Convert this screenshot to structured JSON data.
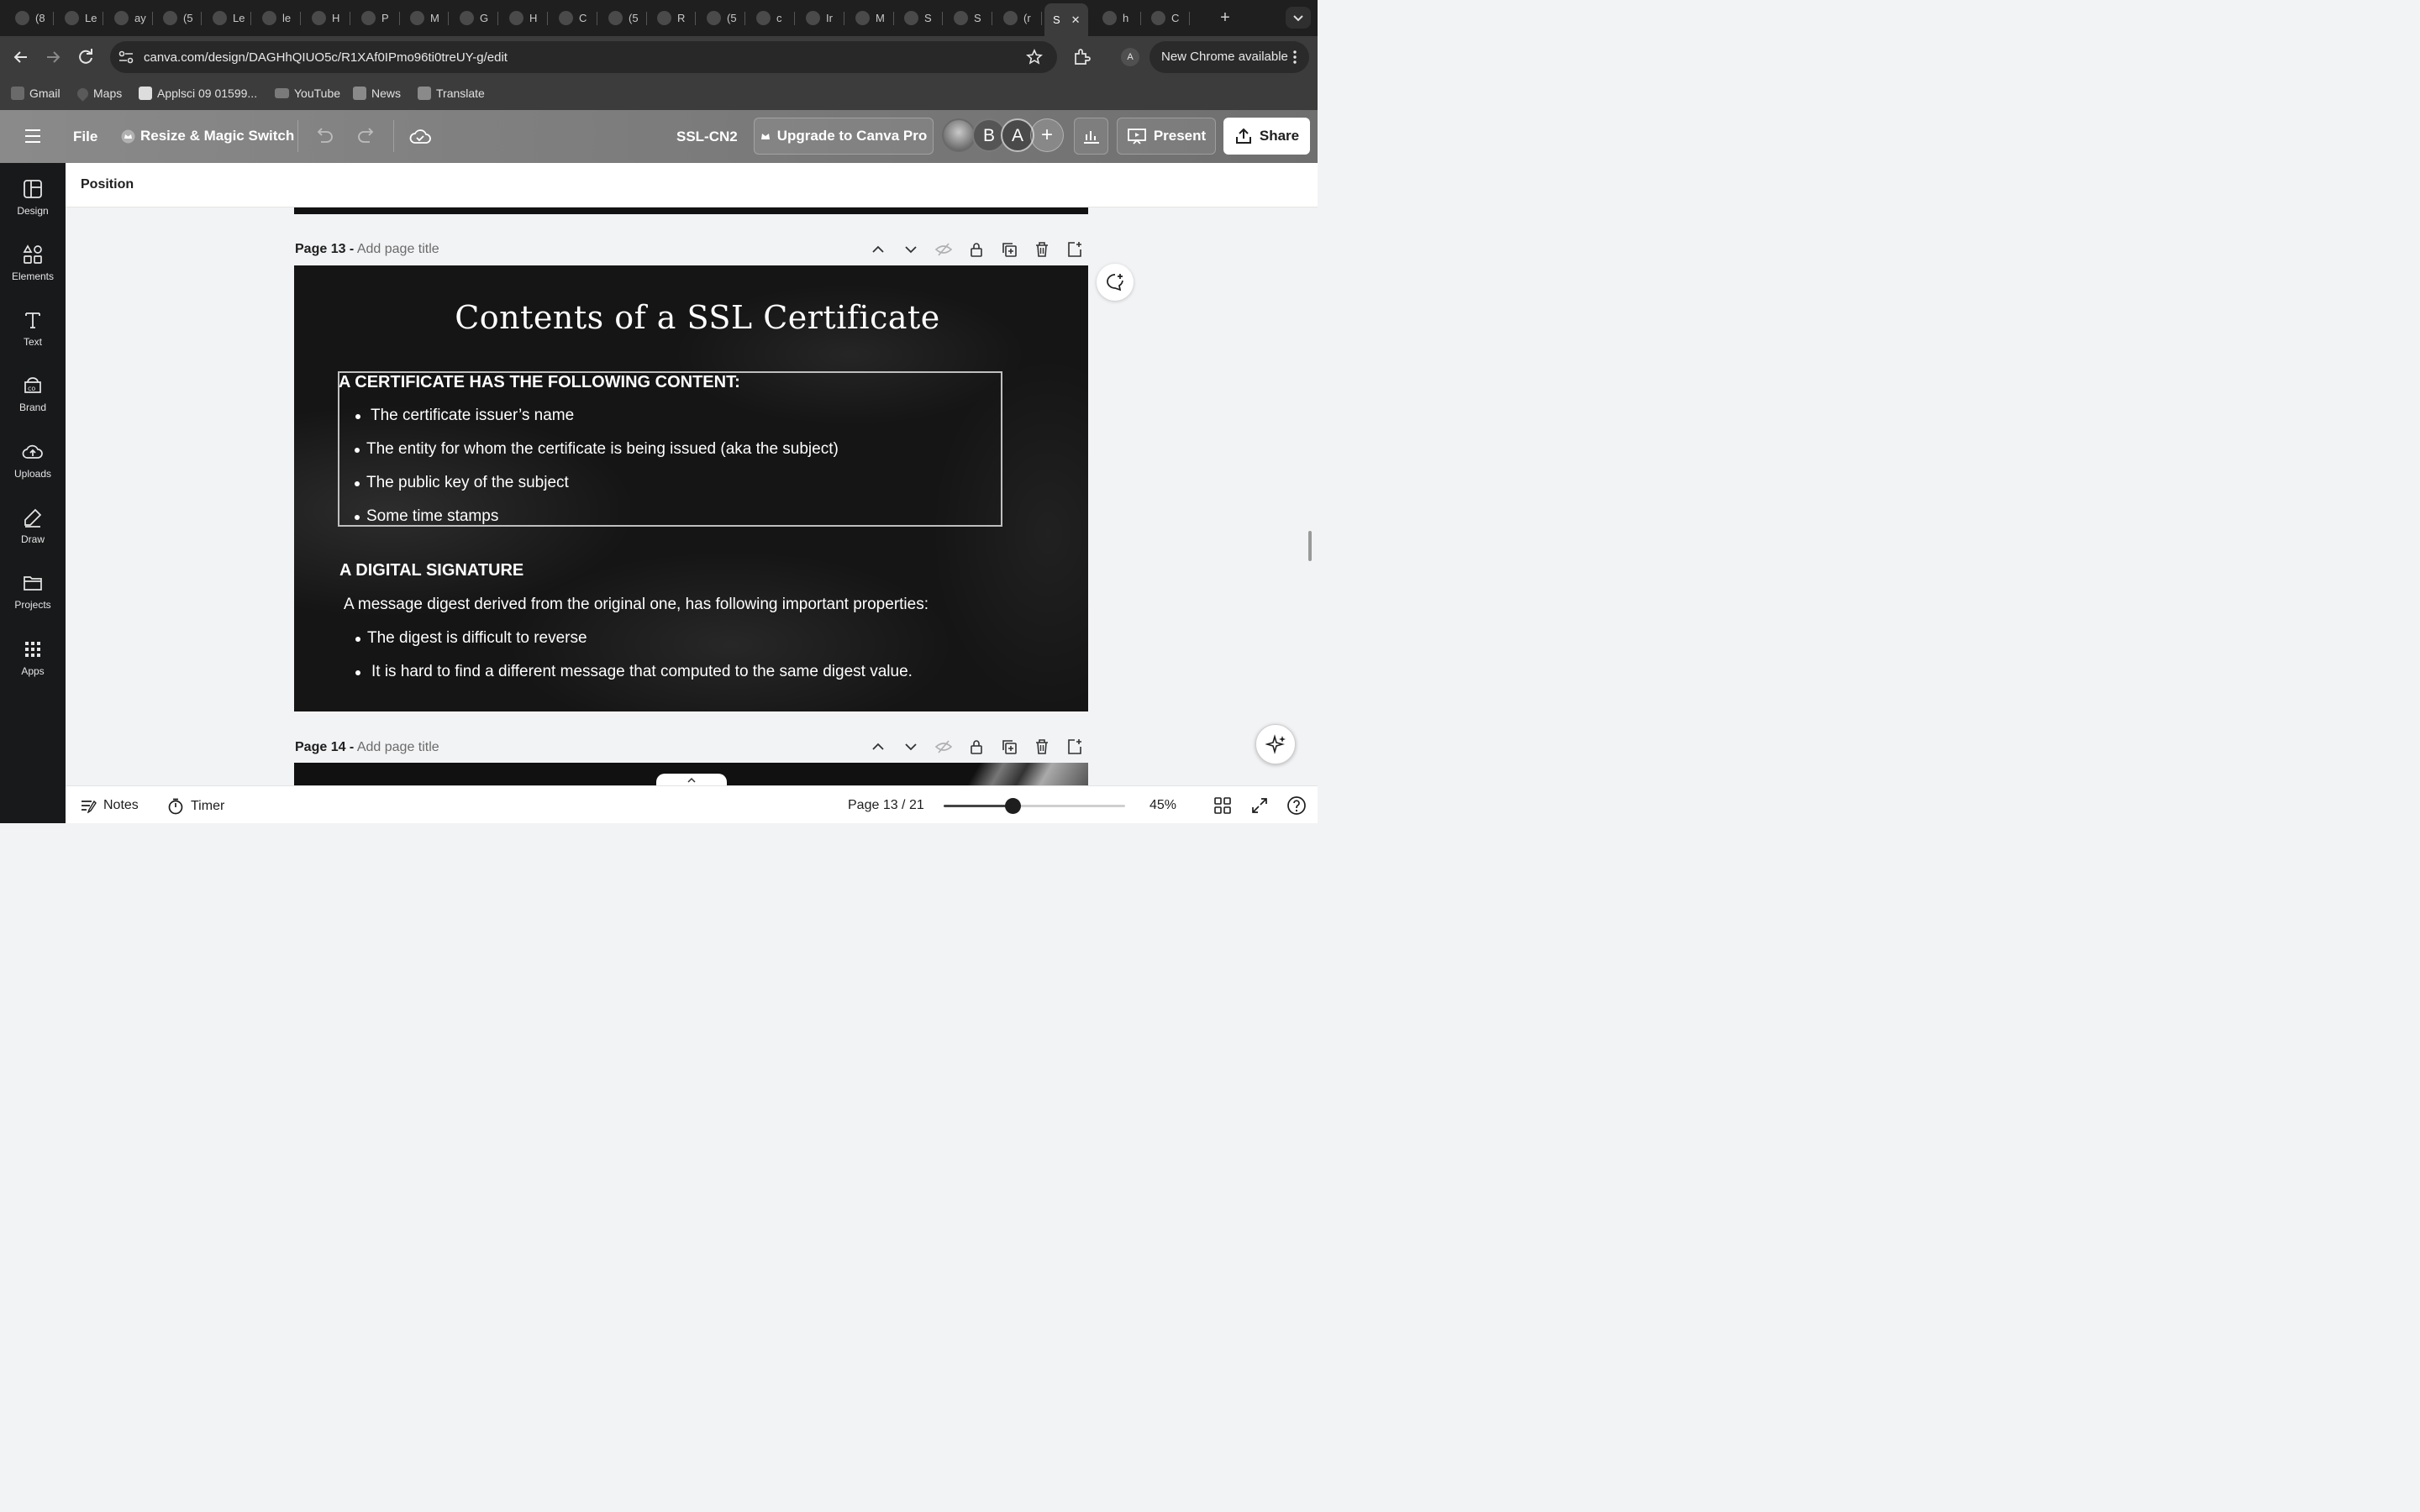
{
  "browser": {
    "tabs": [
      {
        "icon": "whatsapp-icon",
        "label": "(8"
      },
      {
        "icon": "infinity-icon",
        "label": "Le"
      },
      {
        "icon": "infinity-icon",
        "label": "ay"
      },
      {
        "icon": "youtube-icon",
        "label": "(5"
      },
      {
        "icon": "code-icon",
        "label": "Le"
      },
      {
        "icon": "globe-icon",
        "label": "le"
      },
      {
        "icon": "infinity-icon",
        "label": "H"
      },
      {
        "icon": "infinity-icon",
        "label": "P"
      },
      {
        "icon": "infinity-icon",
        "label": "M"
      },
      {
        "icon": "chatgpt-icon",
        "label": "G"
      },
      {
        "icon": "image-icon",
        "label": "H"
      },
      {
        "icon": "image-icon",
        "label": "C"
      },
      {
        "icon": "youtube-icon",
        "label": "(5"
      },
      {
        "icon": "layers-icon",
        "label": "R"
      },
      {
        "icon": "youtube-icon",
        "label": "(5"
      },
      {
        "icon": "google-icon",
        "label": "c"
      },
      {
        "icon": "gmail-icon",
        "label": "Ir"
      },
      {
        "icon": "gmail-icon",
        "label": "M"
      },
      {
        "icon": "k-icon",
        "label": "S"
      },
      {
        "icon": "infinity-icon",
        "label": "S"
      },
      {
        "icon": "gmail-icon",
        "label": "(r"
      },
      {
        "icon": "",
        "label": "S",
        "active": true
      },
      {
        "icon": "google-icon",
        "label": "h"
      },
      {
        "icon": "infinity-icon",
        "label": "C"
      }
    ],
    "url": "canva.com/design/DAGHhQIUO5c/R1XAf0IPmo96ti0treUY-g/edit",
    "profile_initial": "A",
    "update_label": "New Chrome available",
    "bookmarks": [
      "Gmail",
      "Maps",
      "Applsci 09 01599...",
      "YouTube",
      "News",
      "Translate"
    ]
  },
  "canva": {
    "file_label": "File",
    "resize_label": "Resize & Magic Switch",
    "design_title": "SSL-CN2",
    "upgrade_label": "Upgrade to Canva Pro",
    "avatars": [
      "B",
      "A"
    ],
    "present_label": "Present",
    "share_label": "Share",
    "rail": [
      "Design",
      "Elements",
      "Text",
      "Brand",
      "Uploads",
      "Draw",
      "Projects",
      "Apps"
    ],
    "position_label": "Position",
    "pages": [
      {
        "number": "Page 13 -",
        "title_placeholder": "Add page title"
      },
      {
        "number": "Page 14 -",
        "title_placeholder": "Add page title"
      }
    ],
    "slide": {
      "title": "Contents of a SSL Certificate",
      "heading1": "A CERTIFICATE HAS THE FOLLOWING CONTENT:",
      "bullets1": [
        "The certificate issuer’s name",
        "The entity for whom the certificate is being issued (aka the subject)",
        "The public key of the subject",
        "Some time stamps"
      ],
      "heading2": "A DIGITAL SIGNATURE",
      "paragraph": "A message digest derived from the original one, has following important properties:",
      "bullets2": [
        "The digest is difficult to reverse",
        "It is hard to find a different message that computed to the same digest value."
      ]
    },
    "bottom": {
      "notes_label": "Notes",
      "timer_label": "Timer",
      "page_indicator": "Page 13 / 21",
      "zoom_label": "45%",
      "zoom_value": 45
    }
  }
}
